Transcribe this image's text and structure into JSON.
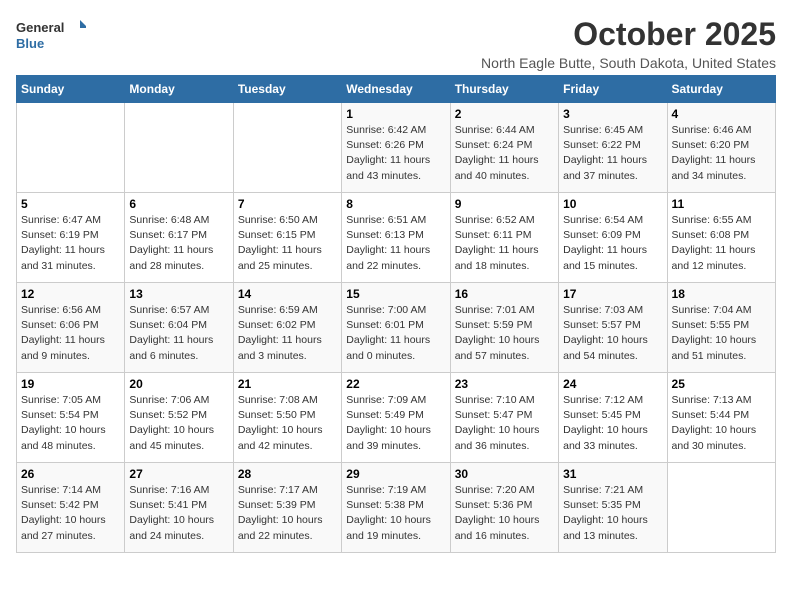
{
  "logo": {
    "general": "General",
    "blue": "Blue"
  },
  "title": "October 2025",
  "location": "North Eagle Butte, South Dakota, United States",
  "days_of_week": [
    "Sunday",
    "Monday",
    "Tuesday",
    "Wednesday",
    "Thursday",
    "Friday",
    "Saturday"
  ],
  "weeks": [
    [
      {
        "day": "",
        "info": ""
      },
      {
        "day": "",
        "info": ""
      },
      {
        "day": "",
        "info": ""
      },
      {
        "day": "1",
        "info": "Sunrise: 6:42 AM\nSunset: 6:26 PM\nDaylight: 11 hours and 43 minutes."
      },
      {
        "day": "2",
        "info": "Sunrise: 6:44 AM\nSunset: 6:24 PM\nDaylight: 11 hours and 40 minutes."
      },
      {
        "day": "3",
        "info": "Sunrise: 6:45 AM\nSunset: 6:22 PM\nDaylight: 11 hours and 37 minutes."
      },
      {
        "day": "4",
        "info": "Sunrise: 6:46 AM\nSunset: 6:20 PM\nDaylight: 11 hours and 34 minutes."
      }
    ],
    [
      {
        "day": "5",
        "info": "Sunrise: 6:47 AM\nSunset: 6:19 PM\nDaylight: 11 hours and 31 minutes."
      },
      {
        "day": "6",
        "info": "Sunrise: 6:48 AM\nSunset: 6:17 PM\nDaylight: 11 hours and 28 minutes."
      },
      {
        "day": "7",
        "info": "Sunrise: 6:50 AM\nSunset: 6:15 PM\nDaylight: 11 hours and 25 minutes."
      },
      {
        "day": "8",
        "info": "Sunrise: 6:51 AM\nSunset: 6:13 PM\nDaylight: 11 hours and 22 minutes."
      },
      {
        "day": "9",
        "info": "Sunrise: 6:52 AM\nSunset: 6:11 PM\nDaylight: 11 hours and 18 minutes."
      },
      {
        "day": "10",
        "info": "Sunrise: 6:54 AM\nSunset: 6:09 PM\nDaylight: 11 hours and 15 minutes."
      },
      {
        "day": "11",
        "info": "Sunrise: 6:55 AM\nSunset: 6:08 PM\nDaylight: 11 hours and 12 minutes."
      }
    ],
    [
      {
        "day": "12",
        "info": "Sunrise: 6:56 AM\nSunset: 6:06 PM\nDaylight: 11 hours and 9 minutes."
      },
      {
        "day": "13",
        "info": "Sunrise: 6:57 AM\nSunset: 6:04 PM\nDaylight: 11 hours and 6 minutes."
      },
      {
        "day": "14",
        "info": "Sunrise: 6:59 AM\nSunset: 6:02 PM\nDaylight: 11 hours and 3 minutes."
      },
      {
        "day": "15",
        "info": "Sunrise: 7:00 AM\nSunset: 6:01 PM\nDaylight: 11 hours and 0 minutes."
      },
      {
        "day": "16",
        "info": "Sunrise: 7:01 AM\nSunset: 5:59 PM\nDaylight: 10 hours and 57 minutes."
      },
      {
        "day": "17",
        "info": "Sunrise: 7:03 AM\nSunset: 5:57 PM\nDaylight: 10 hours and 54 minutes."
      },
      {
        "day": "18",
        "info": "Sunrise: 7:04 AM\nSunset: 5:55 PM\nDaylight: 10 hours and 51 minutes."
      }
    ],
    [
      {
        "day": "19",
        "info": "Sunrise: 7:05 AM\nSunset: 5:54 PM\nDaylight: 10 hours and 48 minutes."
      },
      {
        "day": "20",
        "info": "Sunrise: 7:06 AM\nSunset: 5:52 PM\nDaylight: 10 hours and 45 minutes."
      },
      {
        "day": "21",
        "info": "Sunrise: 7:08 AM\nSunset: 5:50 PM\nDaylight: 10 hours and 42 minutes."
      },
      {
        "day": "22",
        "info": "Sunrise: 7:09 AM\nSunset: 5:49 PM\nDaylight: 10 hours and 39 minutes."
      },
      {
        "day": "23",
        "info": "Sunrise: 7:10 AM\nSunset: 5:47 PM\nDaylight: 10 hours and 36 minutes."
      },
      {
        "day": "24",
        "info": "Sunrise: 7:12 AM\nSunset: 5:45 PM\nDaylight: 10 hours and 33 minutes."
      },
      {
        "day": "25",
        "info": "Sunrise: 7:13 AM\nSunset: 5:44 PM\nDaylight: 10 hours and 30 minutes."
      }
    ],
    [
      {
        "day": "26",
        "info": "Sunrise: 7:14 AM\nSunset: 5:42 PM\nDaylight: 10 hours and 27 minutes."
      },
      {
        "day": "27",
        "info": "Sunrise: 7:16 AM\nSunset: 5:41 PM\nDaylight: 10 hours and 24 minutes."
      },
      {
        "day": "28",
        "info": "Sunrise: 7:17 AM\nSunset: 5:39 PM\nDaylight: 10 hours and 22 minutes."
      },
      {
        "day": "29",
        "info": "Sunrise: 7:19 AM\nSunset: 5:38 PM\nDaylight: 10 hours and 19 minutes."
      },
      {
        "day": "30",
        "info": "Sunrise: 7:20 AM\nSunset: 5:36 PM\nDaylight: 10 hours and 16 minutes."
      },
      {
        "day": "31",
        "info": "Sunrise: 7:21 AM\nSunset: 5:35 PM\nDaylight: 10 hours and 13 minutes."
      },
      {
        "day": "",
        "info": ""
      }
    ]
  ]
}
